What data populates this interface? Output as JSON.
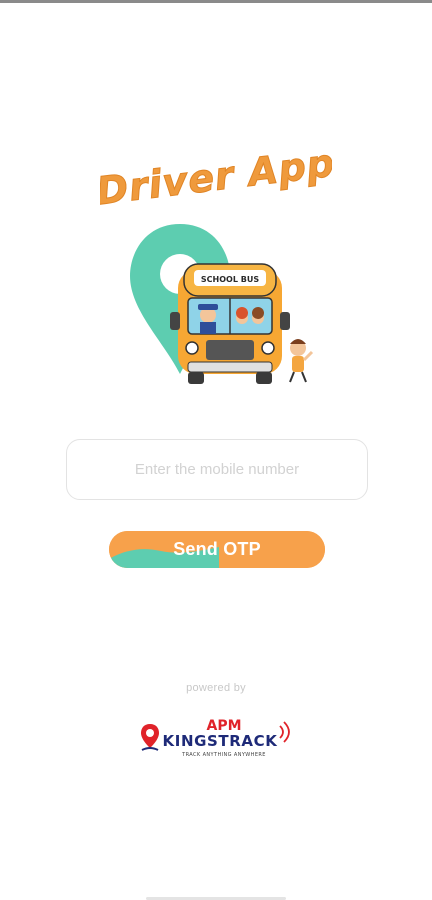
{
  "app": {
    "title": "Driver App",
    "bus_sign": "SCHOOL BUS"
  },
  "login": {
    "mobile_placeholder": "Enter the mobile number",
    "mobile_value": "",
    "send_otp_label": "Send OTP"
  },
  "footer": {
    "powered_by": "powered by",
    "brand_top": "APM",
    "brand_name": "KINGSTRACK",
    "brand_tagline": "TRACK ANYTHING ANYWHERE"
  },
  "colors": {
    "orange": "#f7a14b",
    "teal": "#5dcdb0",
    "brand_red": "#e0232a",
    "brand_navy": "#1e2a78"
  }
}
